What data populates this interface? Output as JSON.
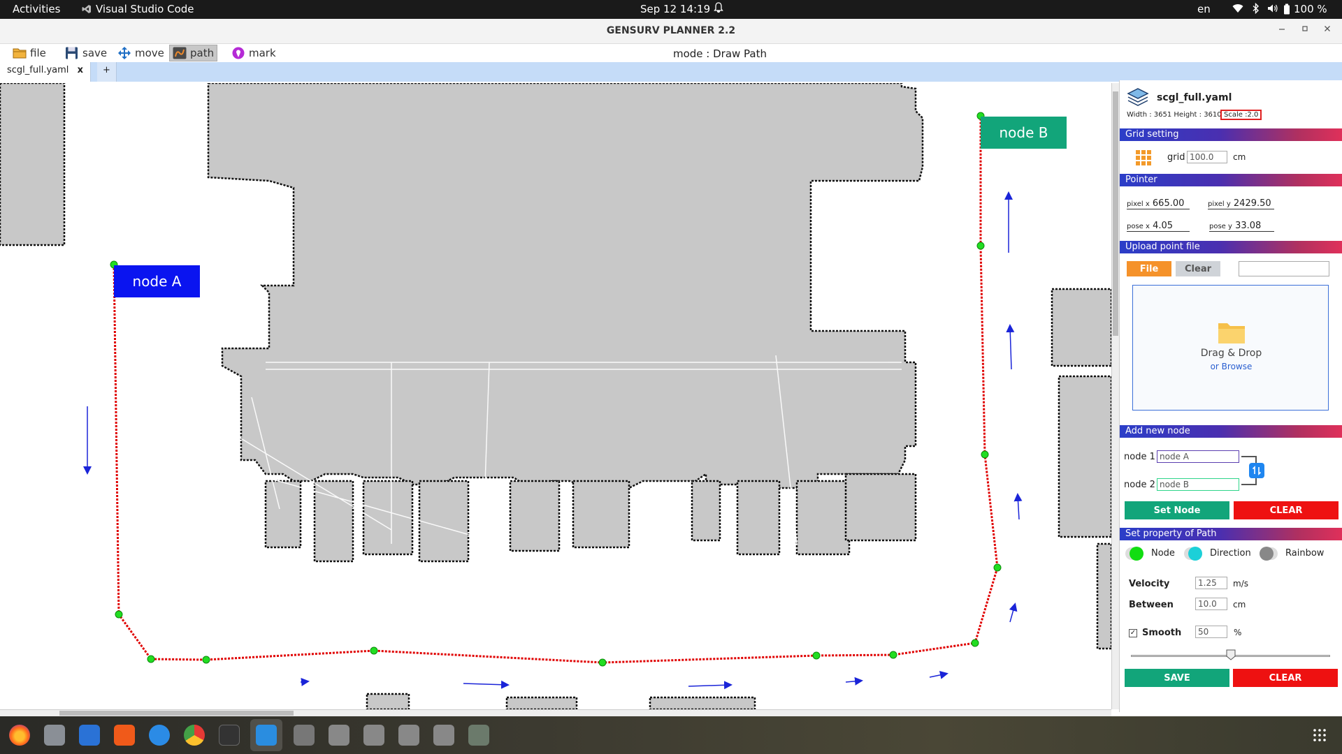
{
  "system_bar": {
    "activities": "Activities",
    "app_name": "Visual Studio Code",
    "datetime": "Sep 12  14:19",
    "language": "en",
    "battery": "100 %"
  },
  "window": {
    "title": "GENSURV PLANNER 2.2"
  },
  "toolbar": {
    "file_label": "file",
    "save_label": "save",
    "move_label": "move",
    "path_label": "path",
    "mark_label": "mark",
    "mode_text": "mode : Draw Path"
  },
  "tabs": {
    "active_tab": "scgl_full.yaml",
    "close_glyph": "x",
    "add_glyph": "+"
  },
  "map": {
    "node_a_label": "node A",
    "node_b_label": "node B",
    "path_color": "#e00000",
    "node_color": "#22dd22",
    "node_a_color": "#0a14f0",
    "node_b_color": "#12a57a"
  },
  "panel": {
    "file_name": "scgl_full.yaml",
    "width_height": "Width : 3651 Height : 3610",
    "scale": "Scale :2.0",
    "grid_setting_header": "Grid setting",
    "grid_label": "grid",
    "grid_value": "100.0",
    "grid_unit": "cm",
    "pointer_header": "Pointer",
    "pixel_x_label": "pixel x",
    "pixel_x_value": "665.00",
    "pixel_y_label": "pixel y",
    "pixel_y_value": "2429.50",
    "pose_x_label": "pose x",
    "pose_x_value": "4.05",
    "pose_y_label": "pose y",
    "pose_y_value": "33.08",
    "upload_header": "Upload point file",
    "file_button": "File",
    "clear_button": "Clear",
    "drag_drop_text": "Drag & Drop",
    "browse_text": "or Browse",
    "add_node_header": "Add new node",
    "node1_label": "node 1",
    "node1_value": "node A",
    "node2_label": "node 2",
    "node2_value": "node B",
    "set_node_button": "Set Node",
    "clear_node_button": "CLEAR",
    "path_property_header": "Set property of Path",
    "toggle_node": "Node",
    "toggle_direction": "Direction",
    "toggle_rainbow": "Rainbow",
    "velocity_label": "Velocity",
    "velocity_value": "1.25",
    "velocity_unit": "m/s",
    "between_label": "Between",
    "between_value": "10.0",
    "between_unit": "cm",
    "smooth_label": "Smooth",
    "smooth_value": "50",
    "smooth_unit": "%",
    "smooth_checked": true,
    "smooth_slider_fraction": 0.5,
    "save_button": "SAVE",
    "clear_path_button": "CLEAR"
  },
  "dock": {
    "apps": [
      "firefox-icon",
      "files-icon",
      "writer-icon",
      "app-center-icon",
      "help-icon",
      "chrome-icon",
      "terminal-icon",
      "vscode-icon",
      "usb-drive-icon",
      "disk-icon-1",
      "disk-icon-2",
      "disk-icon-3",
      "disk-icon-4",
      "trash-icon"
    ]
  }
}
